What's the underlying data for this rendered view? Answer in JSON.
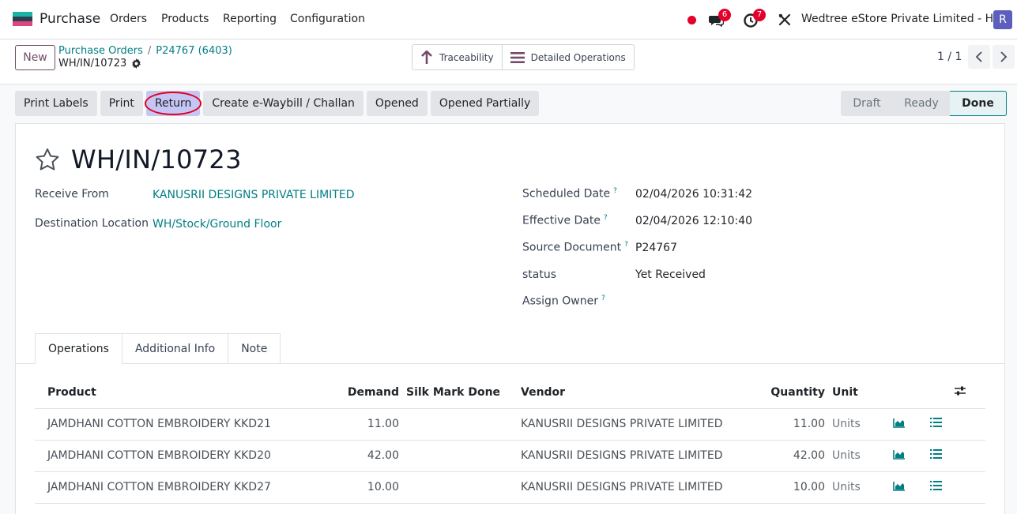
{
  "navbar": {
    "app_name": "Purchase",
    "menus": [
      "Orders",
      "Products",
      "Reporting",
      "Configuration"
    ],
    "messages_count": "6",
    "activities_count": "7",
    "company": "Wedtree eStore Private Limited - HO",
    "avatar_letter": "R",
    "logo_colors": [
      "#1ab3a6",
      "#2d3e50",
      "#e0447c"
    ]
  },
  "control_panel": {
    "new_label": "New",
    "breadcrumb": [
      "Purchase Orders",
      "P24767 (6403)"
    ],
    "current_record": "WH/IN/10723",
    "smart_buttons": [
      {
        "label": "Traceability",
        "icon": "arrow-up-icon"
      },
      {
        "label": "Detailed Operations",
        "icon": "list-icon"
      }
    ],
    "pager": "1 / 1"
  },
  "actions": [
    "Print Labels",
    "Print",
    "Return",
    "Create e-Waybill / Challan",
    "Opened",
    "Opened Partially"
  ],
  "statusbar": {
    "steps": [
      "Draft",
      "Ready",
      "Done"
    ],
    "current": "Done"
  },
  "form": {
    "title": "WH/IN/10723",
    "receive_from_label": "Receive From",
    "receive_from": "KANUSRII DESIGNS PRIVATE LIMITED",
    "destination_label": "Destination Location",
    "destination": "WH/Stock/Ground Floor",
    "scheduled_date_label": "Scheduled Date",
    "scheduled_date": "02/04/2026 10:31:42",
    "effective_date_label": "Effective Date",
    "effective_date": "02/04/2026 12:10:40",
    "source_document_label": "Source Document",
    "source_document": "P24767",
    "status_label": "status",
    "status": "Yet Received",
    "assign_owner_label": "Assign Owner",
    "help_mark": "?"
  },
  "tabs": [
    "Operations",
    "Additional Info",
    "Note"
  ],
  "table": {
    "columns": [
      "Product",
      "Demand",
      "Silk Mark Done",
      "Vendor",
      "Quantity",
      "Unit"
    ],
    "rows": [
      {
        "product": "JAMDHANI COTTON EMBROIDERY KKD21",
        "demand": "11.00",
        "silk": "",
        "vendor": "KANUSRII DESIGNS PRIVATE LIMITED",
        "quantity": "11.00",
        "unit": "Units"
      },
      {
        "product": "JAMDHANI COTTON EMBROIDERY KKD20",
        "demand": "42.00",
        "silk": "",
        "vendor": "KANUSRII DESIGNS PRIVATE LIMITED",
        "quantity": "42.00",
        "unit": "Units"
      },
      {
        "product": "JAMDHANI COTTON EMBROIDERY KKD27",
        "demand": "10.00",
        "silk": "",
        "vendor": "KANUSRII DESIGNS PRIVATE LIMITED",
        "quantity": "10.00",
        "unit": "Units"
      }
    ]
  }
}
